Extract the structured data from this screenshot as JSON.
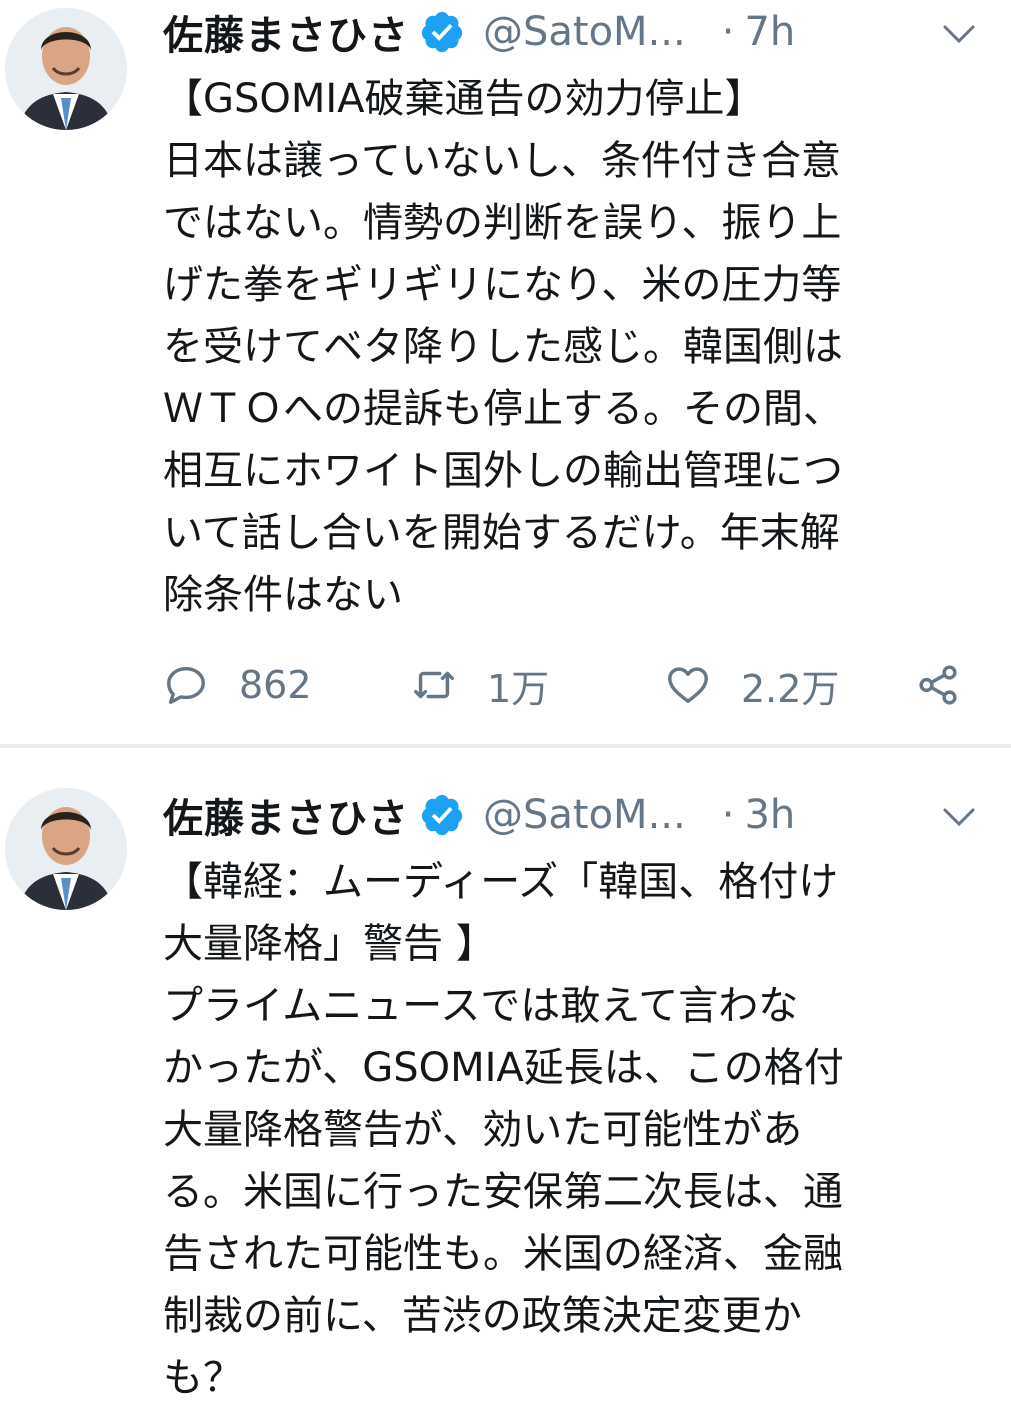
{
  "tweets": [
    {
      "name": "佐藤まさひさ",
      "handle": "@SatoM...",
      "dot": "·",
      "time": "7h",
      "lines": [
        "【GSOMIA破棄通告の効力停止】",
        "日本は譲っていないし、条件付き合意",
        "ではない。情勢の判断を誤り、振り上",
        "げた拳をギリギリになり、米の圧力等",
        "を受けてベタ降りした感じ。韓国側は",
        "ＷＴＯへの提訴も停止する。その間、",
        "相互にホワイト国外しの輸出管理につ",
        "いて話し合いを開始するだけ。年末解",
        "除条件はない"
      ],
      "replies": "862",
      "retweets": "1万",
      "likes": "2.2万"
    },
    {
      "name": "佐藤まさひさ",
      "handle": "@SatoM...",
      "dot": "·",
      "time": "3h",
      "lines": [
        "【韓経：ムーディーズ「韓国、格付け",
        "大量降格」警告 】",
        "プライムニュースでは敢えて言わな",
        "かったが、GSOMIA延長は、この格付",
        "大量降格警告が、効いた可能性があ",
        "る。米国に行った安保第二次長は、通",
        "告された可能性も。米国の経済、金融",
        "制裁の前に、苦渋の政策決定変更か",
        "も？"
      ]
    }
  ],
  "icons": {
    "verified": "verified-badge-icon",
    "caret": "chevron-down-icon",
    "reply": "reply-icon",
    "retweet": "retweet-icon",
    "like": "heart-icon",
    "share": "share-icon"
  },
  "colors": {
    "verified_blue": "#1da1f2",
    "secondary_text": "#657786",
    "primary_text": "#14171a",
    "divider": "#e6ecf0"
  }
}
